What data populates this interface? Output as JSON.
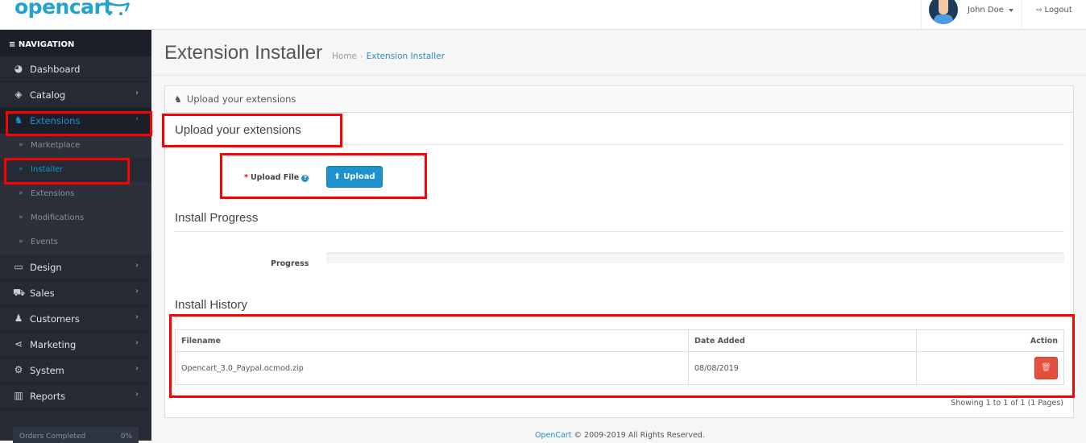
{
  "header": {
    "logo_text": "opencart",
    "user_name": "John Doe",
    "logout_label": "Logout"
  },
  "sidebar": {
    "nav_title": "NAVIGATION",
    "items": [
      {
        "label": "Dashboard",
        "icon": "dashboard-icon"
      },
      {
        "label": "Catalog",
        "icon": "tags-icon"
      },
      {
        "label": "Extensions",
        "icon": "puzzle-icon",
        "active": true
      },
      {
        "label": "Design",
        "icon": "monitor-icon"
      },
      {
        "label": "Sales",
        "icon": "cart-icon"
      },
      {
        "label": "Customers",
        "icon": "user-icon"
      },
      {
        "label": "Marketing",
        "icon": "share-icon"
      },
      {
        "label": "System",
        "icon": "gear-icon"
      },
      {
        "label": "Reports",
        "icon": "bar-chart-icon"
      }
    ],
    "extensions_sub": [
      {
        "label": "Marketplace"
      },
      {
        "label": "Installer",
        "active": true
      },
      {
        "label": "Extensions"
      },
      {
        "label": "Modifications"
      },
      {
        "label": "Events"
      }
    ],
    "orders_completed": {
      "label": "Orders Completed",
      "value": "0%"
    }
  },
  "page": {
    "title": "Extension Installer",
    "breadcrumb": [
      {
        "label": "Home"
      },
      {
        "label": "Extension Installer"
      }
    ],
    "panel_title": "Upload your extensions",
    "upload_section_title": "Upload your extensions",
    "upload_label": "Upload File",
    "upload_button": "Upload",
    "progress_section_title": "Install Progress",
    "progress_label": "Progress",
    "progress_value_percent": 0,
    "history_section_title": "Install History",
    "history_table": {
      "columns": [
        "Filename",
        "Date Added",
        "Action"
      ],
      "rows": [
        {
          "filename": "Opencart_3.0_Paypal.ocmod.zip",
          "date_added": "08/08/2019"
        }
      ]
    },
    "pagination_text": "Showing 1 to 1 of 1 (1 Pages)"
  },
  "footer": {
    "brand_link": "OpenCart",
    "text": "© 2009-2019 All Rights Reserved."
  },
  "colors": {
    "accent": "#1e91cf",
    "danger": "#e3503e",
    "highlight": "#ff0000",
    "sidebar_bg": "#252a35"
  }
}
